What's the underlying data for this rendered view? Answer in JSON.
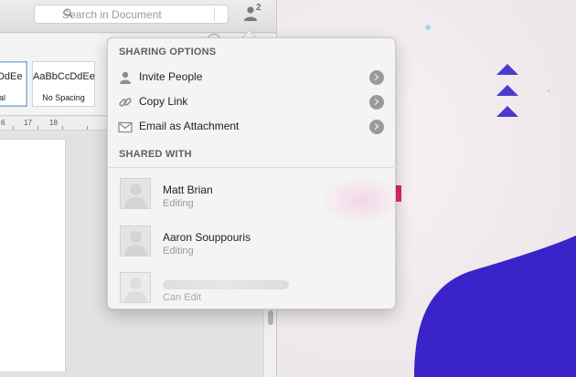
{
  "window": {
    "search_placeholder": "Search in Document",
    "share_count": "2"
  },
  "ribbon": {
    "styles": [
      {
        "sample": "cDdEe",
        "name": "al",
        "selected": true
      },
      {
        "sample": "AaBbCcDdEe",
        "name": "No Spacing",
        "selected": false
      }
    ]
  },
  "ruler": {
    "numbers": [
      "6",
      "17",
      "18"
    ]
  },
  "popover": {
    "sharing_options_header": "SHARING OPTIONS",
    "options": [
      {
        "label": "Invite People",
        "icon": "person-icon"
      },
      {
        "label": "Copy Link",
        "icon": "link-icon"
      },
      {
        "label": "Email as Attachment",
        "icon": "envelope-icon"
      }
    ],
    "shared_with_header": "SHARED WITH",
    "people": [
      {
        "name": "Matt Brian",
        "role": "Editing"
      },
      {
        "name": "Aaron Souppouris",
        "role": "Editing"
      },
      {
        "name": "",
        "role": "Can Edit"
      }
    ]
  },
  "colors": {
    "desktop_blob": "#3a23c8",
    "triangles": "#4b3ad0",
    "pink_mark": "#e0206a"
  }
}
